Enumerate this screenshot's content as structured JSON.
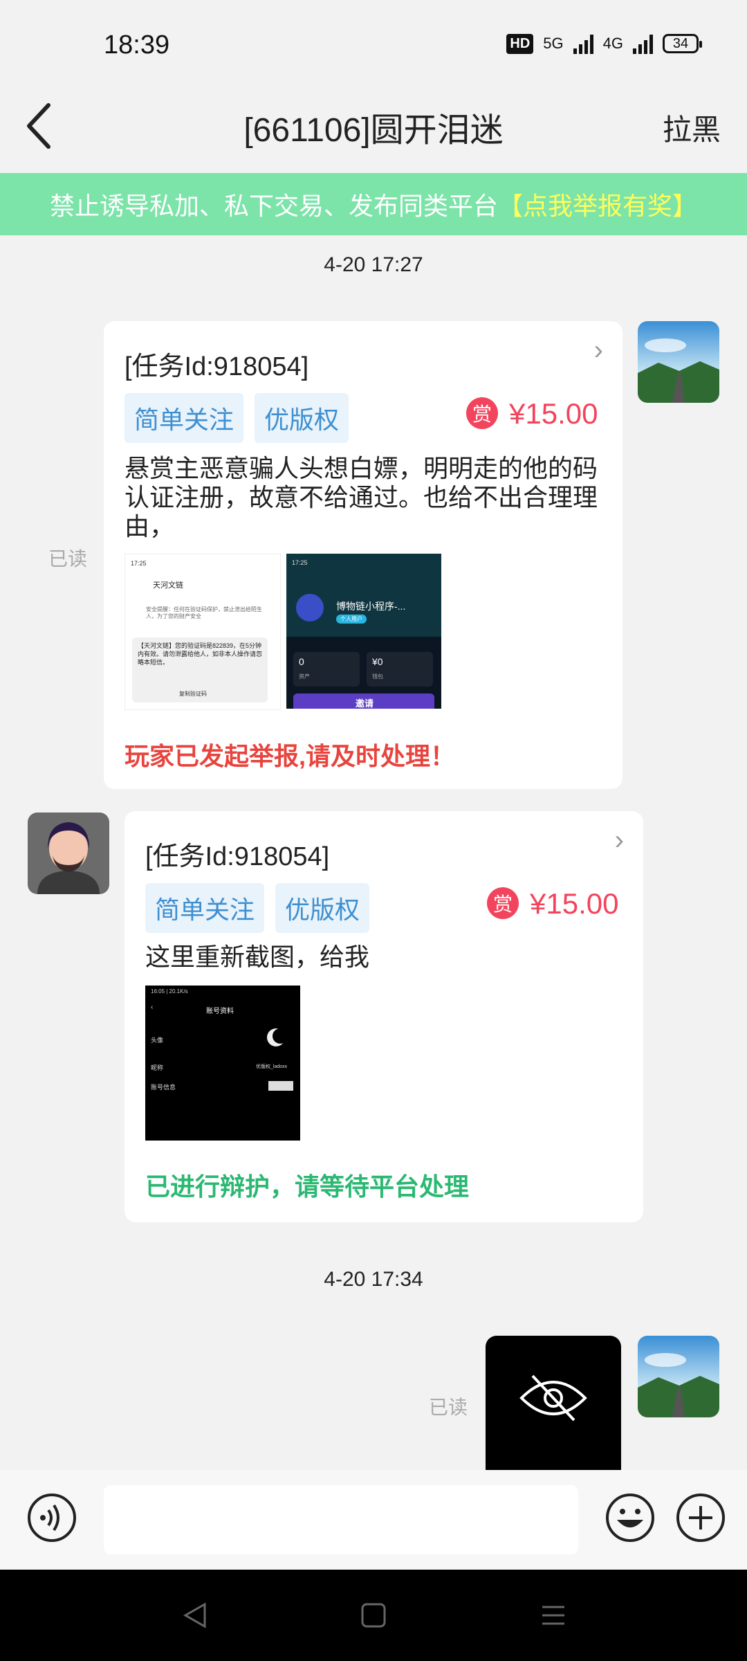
{
  "status_bar": {
    "time": "18:39",
    "hd": "HD",
    "net1": "5G",
    "net2": "4G",
    "battery": "34"
  },
  "header": {
    "title": "[661106]圆开泪迷",
    "block_label": "拉黑"
  },
  "banner": {
    "text": "禁止诱导私加、私下交易、发布同类平台",
    "highlight": "【点我举报有奖】"
  },
  "timestamps": [
    "4-20 17:27",
    "4-20 17:34"
  ],
  "messages": [
    {
      "task_id": "[任务Id:918054]",
      "tags": [
        "简单关注",
        "优版权"
      ],
      "reward_badge": "赏",
      "price": "¥15.00",
      "text": "悬赏主恶意骗人头想白嫖，明明走的他的码认证注册，故意不给通过。也给不出合理理由，",
      "status": "玩家已发起举报,请及时处理！",
      "read": "已读",
      "thumb1": {
        "time": "17:25",
        "contact": "天河文链",
        "warning": "安全提醒：任何在验证码保护，禁止泄出给陌生人，为了您的财产安全",
        "sms": "【天河文链】您的验证码是822839，在5分钟内有效。请勿泄露给他人，如非本人操作请忽略本短信。",
        "copy": "复制验证码"
      },
      "thumb2": {
        "time": "17:25",
        "name": "博物链小程序-...",
        "badge": "个人用户",
        "assets": "0",
        "assets_label": "资产",
        "wallet": "¥0",
        "wallet_label": "钱包",
        "invite": "邀请"
      }
    },
    {
      "task_id": "[任务Id:918054]",
      "tags": [
        "简单关注",
        "优版权"
      ],
      "reward_badge": "赏",
      "price": "¥15.00",
      "text": "这里重新截图，给我",
      "status": "已进行辩护，请等待平台处理",
      "thumb": {
        "time": "16:05 | 20.1K/s",
        "title": "账号资料",
        "row1": "头像",
        "row2": "昵称",
        "row2_value": "优版权_ladoxx",
        "row3": "账号信息"
      }
    },
    {
      "read": "已读"
    }
  ],
  "colors": {
    "banner": "#7ce3a9",
    "accent_red": "#f2445c",
    "accent_green": "#2bb872",
    "tag_text": "#3f8fd0"
  }
}
